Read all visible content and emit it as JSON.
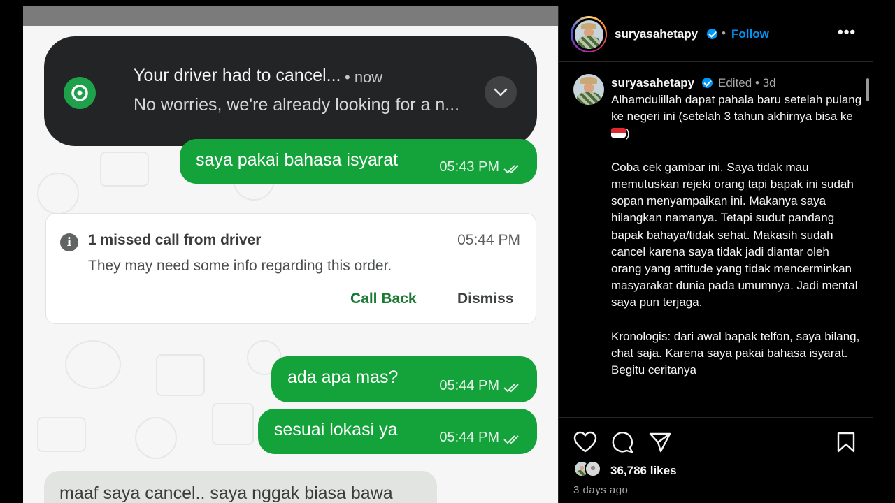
{
  "chat": {
    "notification": {
      "title": "Your driver had to cancel...",
      "time": "• now",
      "body": "No worries, we're already looking for a n..."
    },
    "messages": [
      {
        "text": "saya pakai bahasa isyarat",
        "time": "05:43 PM"
      },
      {
        "text": "ada apa mas?",
        "time": "05:44 PM"
      },
      {
        "text": "sesuai lokasi ya",
        "time": "05:44 PM"
      }
    ],
    "missed_call": {
      "title": "1 missed call from driver",
      "time": "05:44 PM",
      "body": "They may need some info regarding this order.",
      "call_back_label": "Call Back",
      "dismiss_label": "Dismiss"
    },
    "incoming_message": "maaf saya cancel.. saya nggak biasa bawa"
  },
  "post": {
    "username": "suryasahetapy",
    "follow_label": "Follow",
    "more_label": "•••",
    "edited_label": "Edited",
    "edited_meta": "• 3d",
    "caption_line1": "Alhamdulillah dapat pahala baru setelah pulang ke negeri ini (setelah 3 tahun akhirnya bisa ke",
    "caption_line1_end": ")",
    "caption_rest": "\n\nCoba cek gambar ini. Saya tidak mau memutuskan rejeki orang tapi bapak ini sudah sopan menyampaikan ini. Makanya saya hilangkan namanya. Tetapi sudut pandang bapak bahaya/tidak sehat. Makasih sudah cancel karena saya tidak jadi diantar oleh orang yang attitude yang tidak mencerminkan masyarakat dunia pada umumnya. Jadi mental saya pun terjaga.\n\nKronologis: dari awal bapak telfon, saya bilang, chat saja. Karena saya pakai bahasa isyarat. Begitu ceritanya",
    "likes": "36,786 likes",
    "time_ago": "3 days ago"
  },
  "colors": {
    "bubble_green": "#14a33a",
    "link_blue": "#0095f6",
    "callback_green": "#1c7a34"
  },
  "icons": [
    "grab-app-icon",
    "chevron-down-icon",
    "double-check-icon",
    "info-icon",
    "verified-badge-icon",
    "heart-icon",
    "comment-icon",
    "share-icon",
    "bookmark-icon"
  ]
}
